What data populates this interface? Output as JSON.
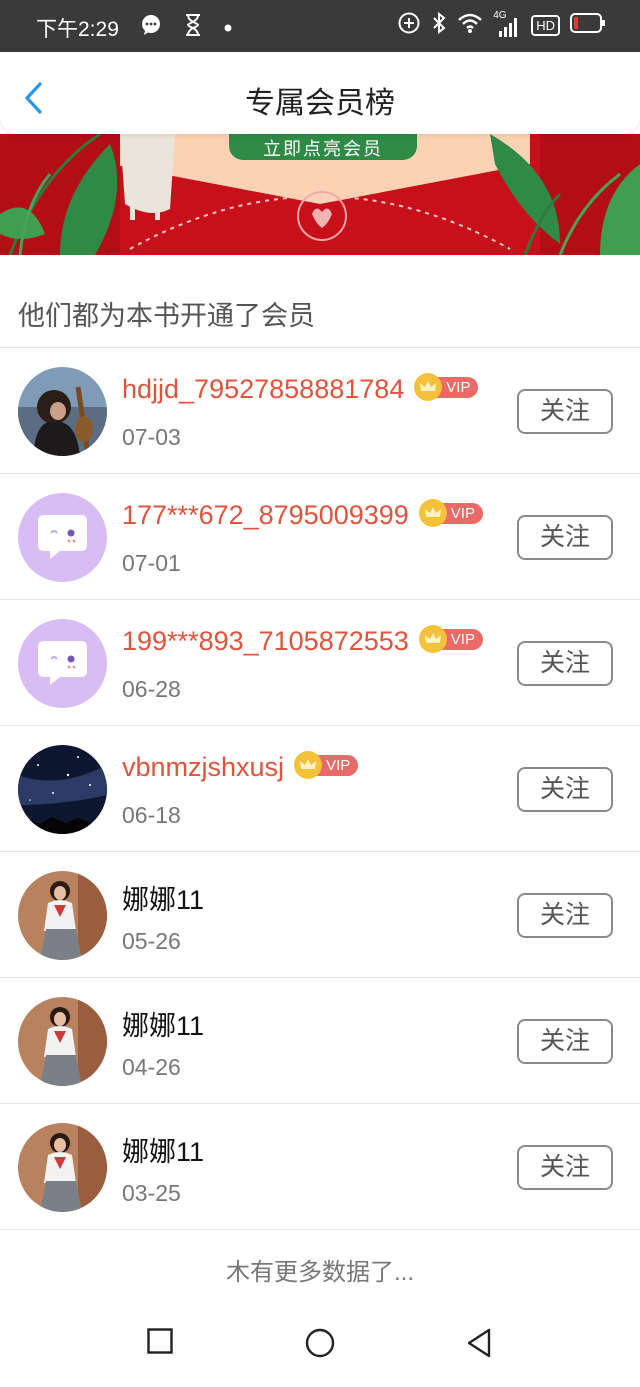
{
  "status_bar": {
    "time": "下午2:29",
    "left_icons": [
      "chat-bubble-icon",
      "hourglass-icon",
      "dot-icon"
    ],
    "right_icons": [
      "add-circle-icon",
      "bluetooth-icon",
      "wifi-icon",
      "signal-4g-icon",
      "hd-icon",
      "battery-low-icon"
    ],
    "network_label": "4G",
    "hd_label": "HD",
    "battery_color": "#e53935"
  },
  "header": {
    "title": "专属会员榜",
    "back_icon": "chevron-left-icon",
    "accent_color": "#2196f3"
  },
  "banner": {
    "button_label": "立即点亮会员",
    "background_color": "#c8101a"
  },
  "section_title": "他们都为本书开通了会员",
  "follow_label": "关注",
  "vip_label": "VIP",
  "members": [
    {
      "name": "hdjjd_79527858881784",
      "date": "07-03",
      "vip": true,
      "avatar": "girl-violin-photo"
    },
    {
      "name": "177***672_8795009399",
      "date": "07-01",
      "vip": true,
      "avatar": "default-chat-avatar"
    },
    {
      "name": "199***893_7105872553",
      "date": "06-28",
      "vip": true,
      "avatar": "default-chat-avatar"
    },
    {
      "name": "vbnmzjshxusj",
      "date": "06-18",
      "vip": true,
      "avatar": "night-sky-photo"
    },
    {
      "name": "娜娜11",
      "date": "05-26",
      "vip": false,
      "avatar": "girl-uniform-photo"
    },
    {
      "name": "娜娜11",
      "date": "04-26",
      "vip": false,
      "avatar": "girl-uniform-photo"
    },
    {
      "name": "娜娜11",
      "date": "03-25",
      "vip": false,
      "avatar": "girl-uniform-photo"
    }
  ],
  "footer_text": "木有更多数据了...",
  "nav_bar": [
    "recent-apps-square-icon",
    "home-circle-icon",
    "back-triangle-icon"
  ]
}
